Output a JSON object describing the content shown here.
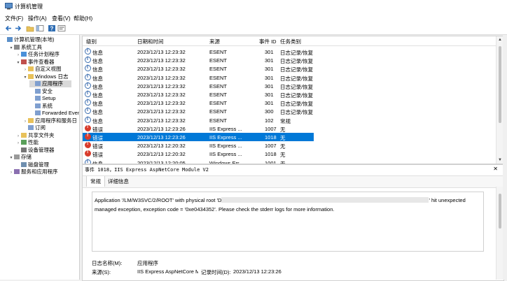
{
  "window": {
    "title": "计算机管理"
  },
  "menu": [
    "文件(F)",
    "操作(A)",
    "查看(V)",
    "帮助(H)"
  ],
  "toolbar": {
    "icons": [
      "back-arrow-icon",
      "forward-arrow-icon",
      "up-folder-icon",
      "show-hide-tree-icon",
      "help-icon",
      "properties-icon"
    ]
  },
  "tree": [
    {
      "label": "计算机管理(本地)",
      "level": 0,
      "exp": "",
      "icon": "computer"
    },
    {
      "label": "系统工具",
      "level": 1,
      "exp": "▾",
      "icon": "tools"
    },
    {
      "label": "任务计划程序",
      "level": 2,
      "exp": "›",
      "icon": "clock"
    },
    {
      "label": "事件查看器",
      "level": 2,
      "exp": "▾",
      "icon": "viewer"
    },
    {
      "label": "自定义视图",
      "level": 3,
      "exp": "›",
      "icon": "folder"
    },
    {
      "label": "Windows 日志",
      "level": 3,
      "exp": "▾",
      "icon": "folder"
    },
    {
      "label": "应用程序",
      "level": 4,
      "exp": "",
      "icon": "log",
      "selected": true
    },
    {
      "label": "安全",
      "level": 4,
      "exp": "",
      "icon": "log"
    },
    {
      "label": "Setup",
      "level": 4,
      "exp": "",
      "icon": "log"
    },
    {
      "label": "系统",
      "level": 4,
      "exp": "",
      "icon": "log"
    },
    {
      "label": "Forwarded Even",
      "level": 4,
      "exp": "",
      "icon": "log"
    },
    {
      "label": "应用程序和服务日",
      "level": 3,
      "exp": "›",
      "icon": "folder"
    },
    {
      "label": "订阅",
      "level": 3,
      "exp": "",
      "icon": "log"
    },
    {
      "label": "共享文件夹",
      "level": 2,
      "exp": "›",
      "icon": "folder"
    },
    {
      "label": "性能",
      "level": 2,
      "exp": "›",
      "icon": "perf"
    },
    {
      "label": "设备管理器",
      "level": 2,
      "exp": "",
      "icon": "device"
    },
    {
      "label": "存储",
      "level": 1,
      "exp": "▾",
      "icon": "storage"
    },
    {
      "label": "磁盘管理",
      "level": 2,
      "exp": "",
      "icon": "disk"
    },
    {
      "label": "服务和应用程序",
      "level": 1,
      "exp": "›",
      "icon": "services"
    }
  ],
  "columns": {
    "level": "级别",
    "datetime": "日期和时间",
    "source": "来源",
    "event_id": "事件 ID",
    "category": "任务类别"
  },
  "events": [
    {
      "type": "info",
      "level": "信息",
      "datetime": "2023/12/13 12:23:32",
      "source": "ESENT",
      "id": "301",
      "category": "日志记录/恢复"
    },
    {
      "type": "info",
      "level": "信息",
      "datetime": "2023/12/13 12:23:32",
      "source": "ESENT",
      "id": "301",
      "category": "日志记录/恢复"
    },
    {
      "type": "info",
      "level": "信息",
      "datetime": "2023/12/13 12:23:32",
      "source": "ESENT",
      "id": "301",
      "category": "日志记录/恢复"
    },
    {
      "type": "info",
      "level": "信息",
      "datetime": "2023/12/13 12:23:32",
      "source": "ESENT",
      "id": "301",
      "category": "日志记录/恢复"
    },
    {
      "type": "info",
      "level": "信息",
      "datetime": "2023/12/13 12:23:32",
      "source": "ESENT",
      "id": "301",
      "category": "日志记录/恢复"
    },
    {
      "type": "info",
      "level": "信息",
      "datetime": "2023/12/13 12:23:32",
      "source": "ESENT",
      "id": "301",
      "category": "日志记录/恢复"
    },
    {
      "type": "info",
      "level": "信息",
      "datetime": "2023/12/13 12:23:32",
      "source": "ESENT",
      "id": "301",
      "category": "日志记录/恢复"
    },
    {
      "type": "info",
      "level": "信息",
      "datetime": "2023/12/13 12:23:32",
      "source": "ESENT",
      "id": "300",
      "category": "日志记录/恢复"
    },
    {
      "type": "info",
      "level": "信息",
      "datetime": "2023/12/13 12:23:32",
      "source": "ESENT",
      "id": "102",
      "category": "常规"
    },
    {
      "type": "error",
      "level": "错误",
      "datetime": "2023/12/13 12:23:26",
      "source": "IIS Express ...",
      "id": "1007",
      "category": "无"
    },
    {
      "type": "error",
      "level": "错误",
      "datetime": "2023/12/13 12:23:26",
      "source": "IIS Express ...",
      "id": "1018",
      "category": "无",
      "selected": true
    },
    {
      "type": "error",
      "level": "错误",
      "datetime": "2023/12/13 12:20:32",
      "source": "IIS Express ...",
      "id": "1007",
      "category": "无"
    },
    {
      "type": "error",
      "level": "错误",
      "datetime": "2023/12/13 12:20:32",
      "source": "IIS Express ...",
      "id": "1018",
      "category": "无"
    },
    {
      "type": "info",
      "level": "信息",
      "datetime": "2023/12/13 12:20:05",
      "source": "Windows Err...",
      "id": "1001",
      "category": "无"
    }
  ],
  "detail": {
    "title": "事件 1018，IIS Express AspNetCore Module V2",
    "close": "✕",
    "tabs": [
      "常规",
      "详细信息"
    ],
    "message_before": "Application '/LM/W3SVC/2/ROOT' with physical root 'D",
    "message_after": "' hit unexpected",
    "message_line2": "managed exception, exception code = '0xe0434352'. Please check the stderr logs for more information.",
    "log_name_label": "日志名称(M):",
    "log_name_value": "应用程序",
    "source_label": "来源(S):",
    "source_value": "IIS Express AspNetCore Mo",
    "recorded_label": "记录时间(D):",
    "recorded_value": "2023/12/13 12:23:26"
  },
  "colors": {
    "selection": "#0078d7",
    "error": "#d83b2b",
    "info": "#2a5ca8"
  }
}
